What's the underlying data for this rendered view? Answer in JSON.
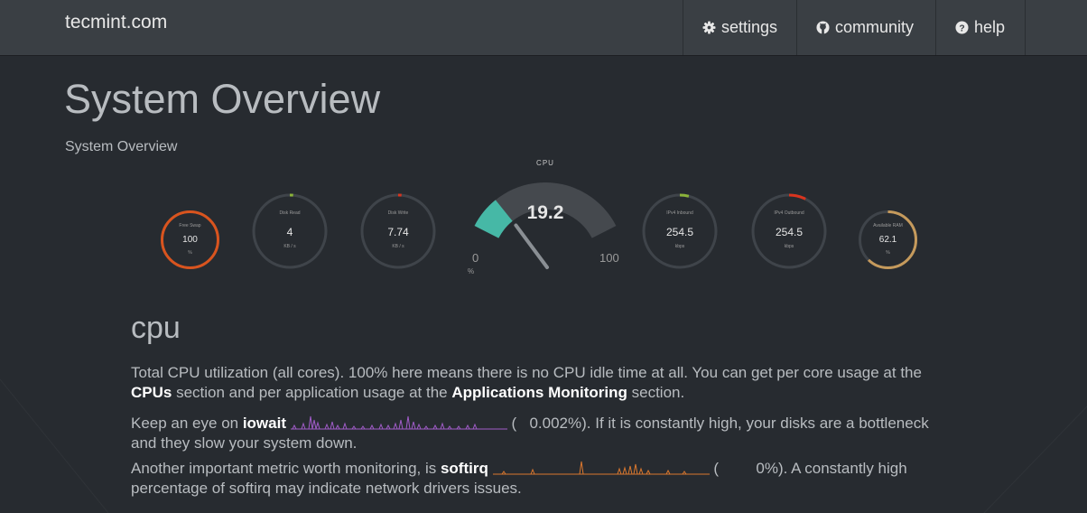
{
  "navbar": {
    "brand": "tecmint.com",
    "items": [
      {
        "label": "settings",
        "icon": "gear-icon"
      },
      {
        "label": "community",
        "icon": "github-icon"
      },
      {
        "label": "help",
        "icon": "question-circle-icon"
      }
    ]
  },
  "page": {
    "title": "System Overview",
    "subtitle": "System Overview"
  },
  "gauges": [
    {
      "label": "Free Swap",
      "value": "100",
      "unit": "%",
      "percent": 100,
      "color": "#d9541e"
    },
    {
      "label": "Disk Read",
      "value": "4",
      "unit": "KB / s",
      "percent": 2,
      "color": "#8bb33a"
    },
    {
      "label": "Disk Write",
      "value": "7.74",
      "unit": "KB / s",
      "percent": 3,
      "color": "#d9341e"
    },
    {
      "label": "IPv4 Inbound",
      "value": "254.5",
      "unit": "kbps",
      "percent": 8,
      "color": "#8bb33a"
    },
    {
      "label": "IPv4 Outbound",
      "value": "254.5",
      "unit": "kbps",
      "percent": 15,
      "color": "#d9341e"
    },
    {
      "label": "Available RAM",
      "value": "62.1",
      "unit": "%",
      "percent": 62.1,
      "color": "#c59a5c"
    }
  ],
  "cpu_gauge": {
    "title": "CPU",
    "value": "19.2",
    "min": "0",
    "max": "100",
    "unit": "%",
    "percent": 19.2,
    "color": "#46b8a6"
  },
  "section": {
    "heading": "cpu",
    "para1_text1": "Total CPU utilization (all cores). 100% here means there is no CPU idle time at all. You can get per core usage at the",
    "para1_link1": "CPUs",
    "para1_text2": " section and per application usage at the ",
    "para1_link2": "Applications Monitoring",
    "para1_text3": " section.",
    "para2_text1": "Keep an eye on ",
    "para2_bold": "iowait",
    "para2_open": " (",
    "para2_value": "0.002%",
    "para2_text2": "). If it is constantly high, your disks are a bottleneck",
    "para2_text3": "and they slow your system down.",
    "para3_text1": "Another important metric worth monitoring, is ",
    "para3_bold": "softirq",
    "para3_open": " (",
    "para3_value": "0%",
    "para3_text2": "). A constantly high",
    "para3_text3": "percentage of softirq may indicate network drivers issues.",
    "iowait_color": "#a05cc8",
    "softirq_color": "#d9772e"
  }
}
